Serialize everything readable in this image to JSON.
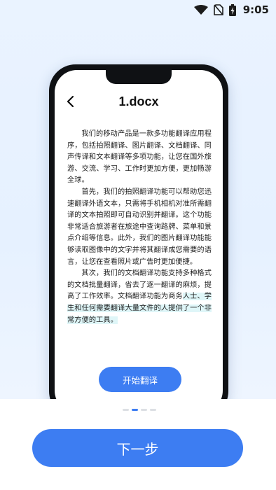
{
  "status_bar": {
    "time": "9:05",
    "icons": [
      "wifi-icon",
      "no-sim-icon",
      "battery-charging-icon"
    ]
  },
  "phone_screen": {
    "title": "1.docx",
    "back_icon": "chevron-left-icon",
    "paragraphs": [
      "我们的移动产品是一款多功能翻译应用程序，包括拍照翻译、图片翻译、文档翻译、同声传译和文本翻译等多项功能，让您在国外旅游、交流、学习、工作时更加方便，更加畅游全球。",
      "首先，我们的拍照翻译功能可以帮助您迅速翻译外语文本，只需将手机相机对准所需翻译的文本拍照即可自动识别并翻译。这个功能非常适合旅游者在旅途中查询路牌、菜单和景点介绍等信息。此外，我们的图片翻译功能能够读取图像中的文字并将其翻译成您需要的语言，让您在查看照片或广告时更加便捷。"
    ],
    "paragraph3_plain": "其次，我们的文档翻译功能支持多种格式的文档批量翻译，省去了逐一翻译的麻烦，提高了工作效率。文档翻译功能为商务",
    "paragraph3_highlight": "人士、学生和任何需要翻译大量文件的人提供了一个非常方便的工具。",
    "translate_button": "开始翻译"
  },
  "pager": {
    "total": 4,
    "active_index": 1
  },
  "next_button": "下一步",
  "colors": {
    "accent": "#3d7df2",
    "highlight": "#dff6f8",
    "background_top": "#e6f1ff"
  }
}
